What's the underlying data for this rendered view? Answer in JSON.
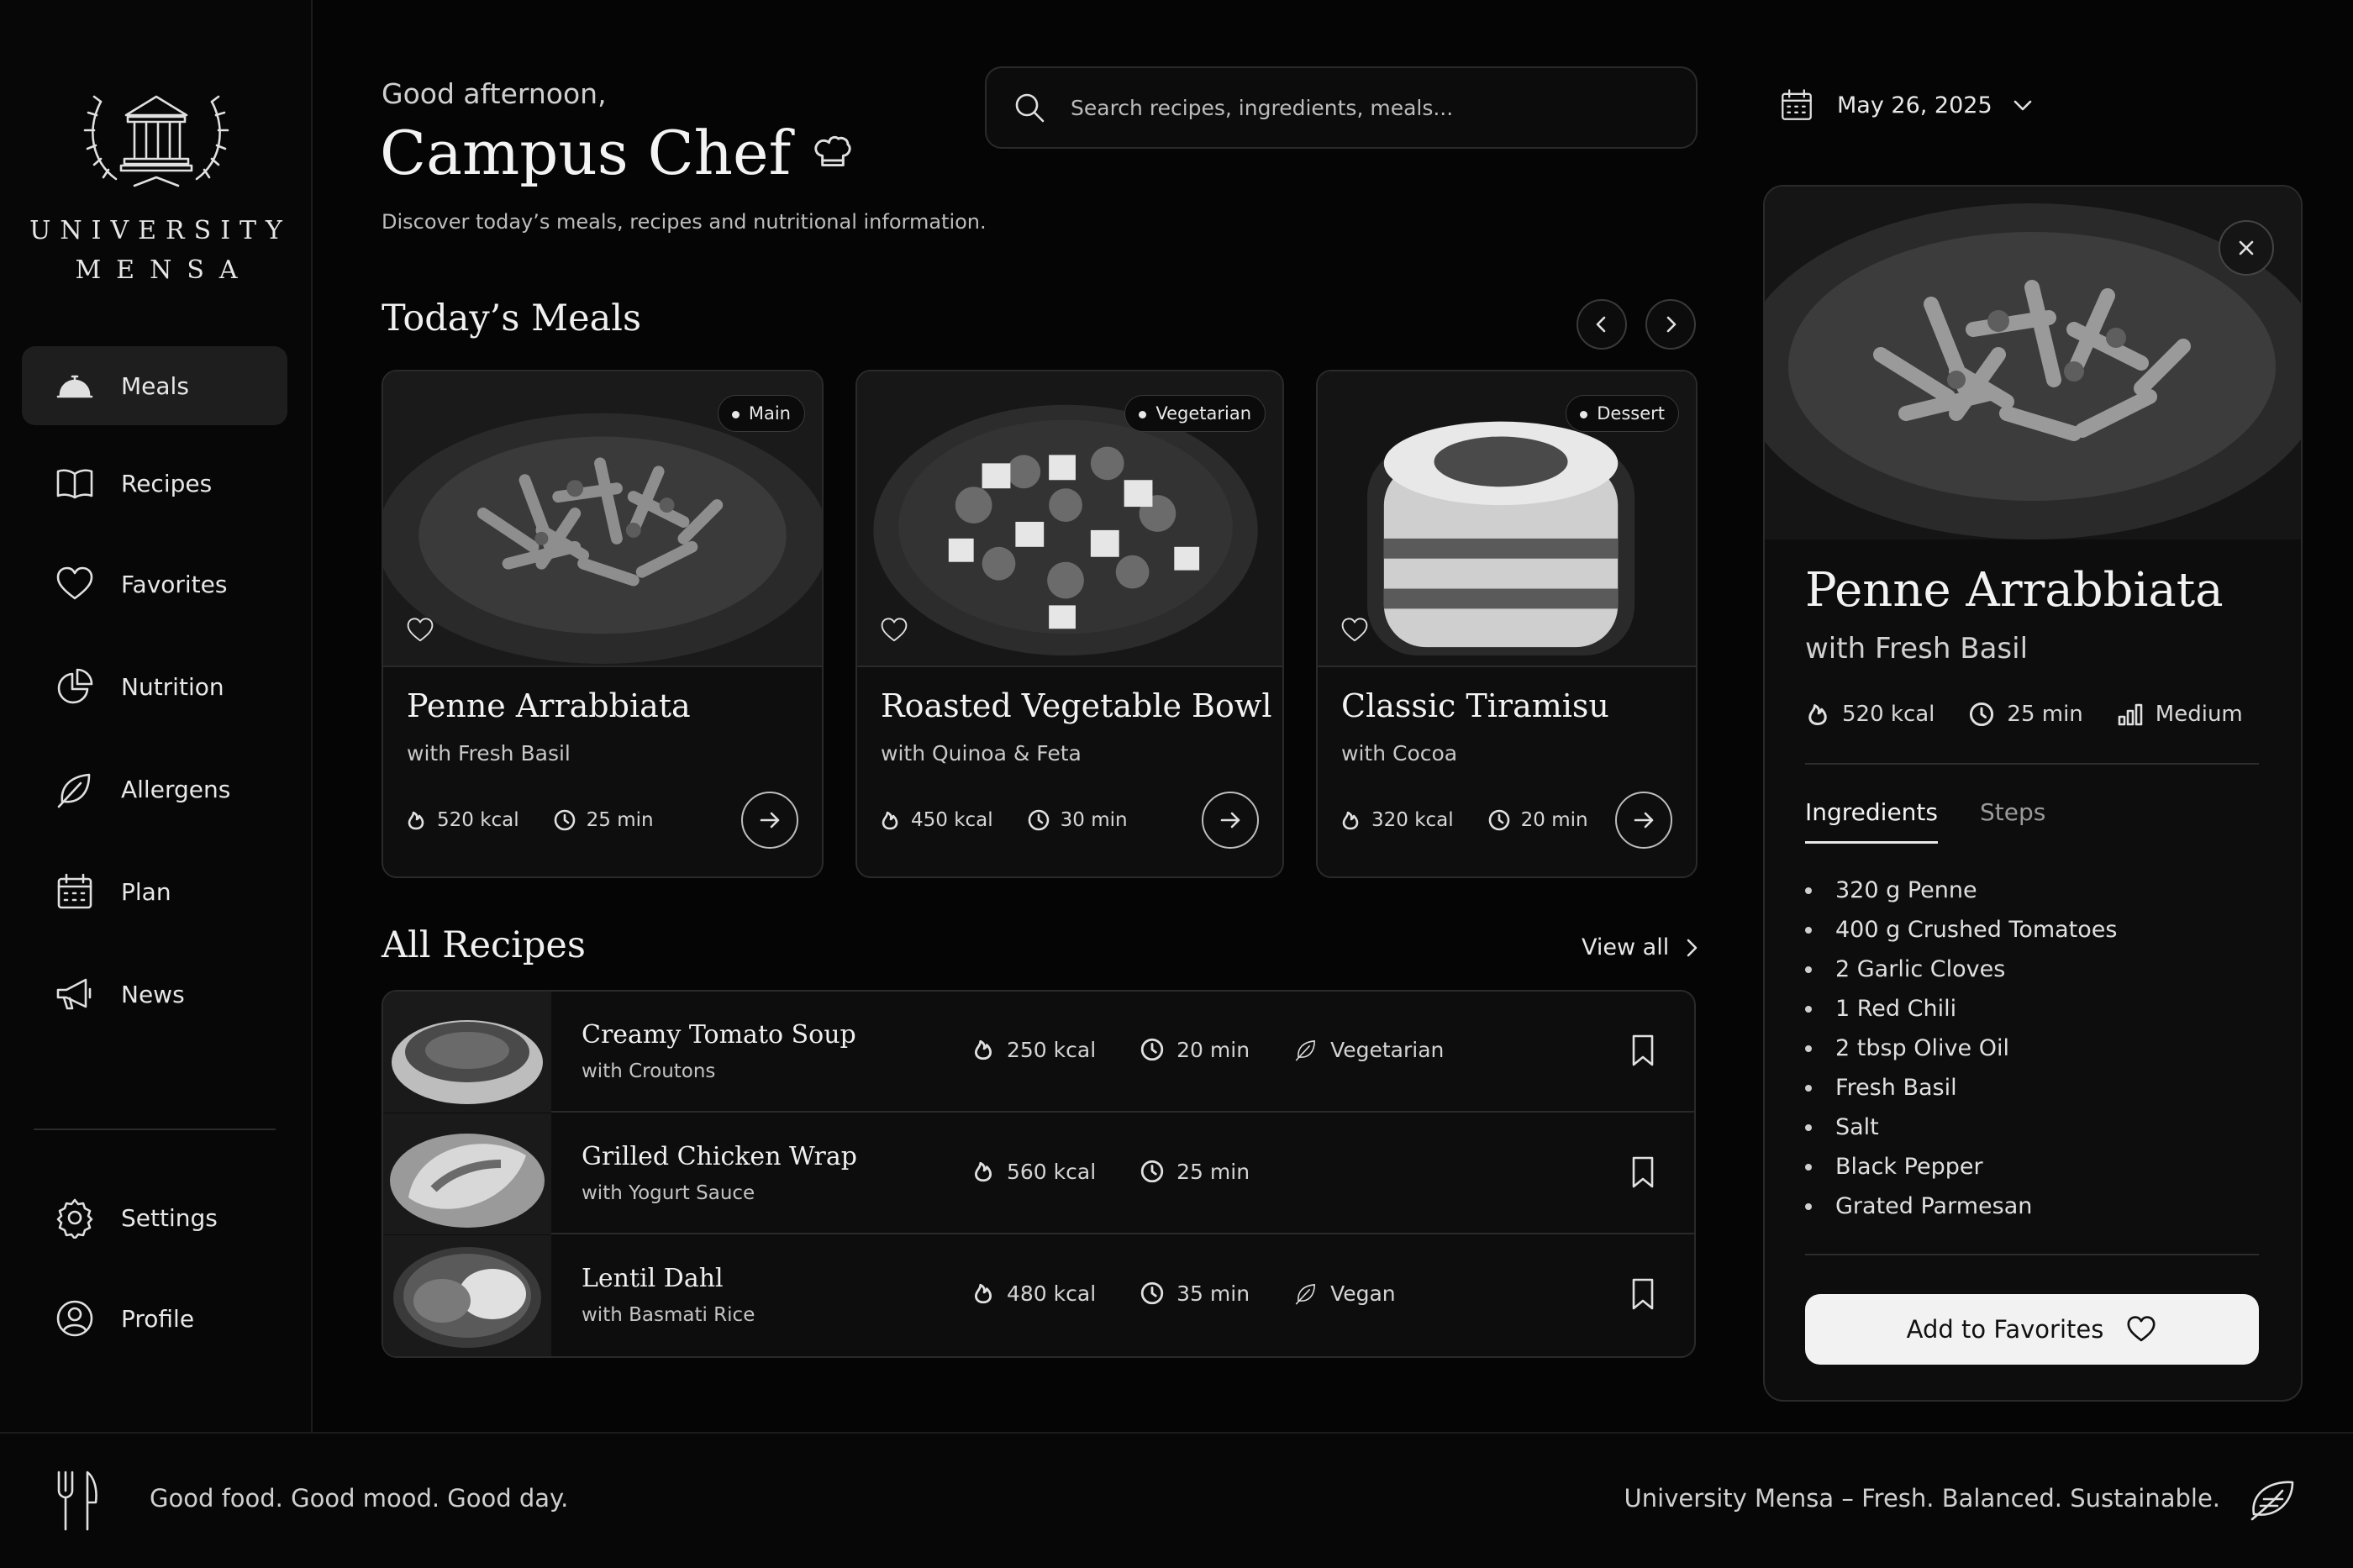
{
  "brand": {
    "line1": "UNIVERSITY",
    "line2": "MENSA",
    "logo_icon": "laurel-building-icon"
  },
  "sidebar": {
    "items": [
      {
        "label": "Meals",
        "icon": "cloche-icon",
        "active": true
      },
      {
        "label": "Recipes",
        "icon": "book-icon",
        "active": false
      },
      {
        "label": "Favorites",
        "icon": "heart-icon",
        "active": false
      },
      {
        "label": "Nutrition",
        "icon": "pie-chart-icon",
        "active": false
      },
      {
        "label": "Allergens",
        "icon": "leaf-icon",
        "active": false
      },
      {
        "label": "Plan",
        "icon": "calendar-icon",
        "active": false
      },
      {
        "label": "News",
        "icon": "megaphone-icon",
        "active": false
      }
    ],
    "bottom_items": [
      {
        "label": "Settings",
        "icon": "gear-icon"
      },
      {
        "label": "Profile",
        "icon": "user-circle-icon"
      }
    ]
  },
  "header": {
    "greeting": "Good afternoon,",
    "title": "Campus Chef",
    "subtitle": "Discover today’s meals, recipes and nutritional information.",
    "search_placeholder": "Search recipes, ingredients, meals...",
    "date": "May 26, 2025"
  },
  "todays_meals": {
    "heading": "Today’s Meals",
    "cards": [
      {
        "badge": "Main",
        "name": "Penne Arrabbiata",
        "subtitle": "with Fresh Basil",
        "kcal": "520 kcal",
        "time": "25 min"
      },
      {
        "badge": "Vegetarian",
        "name": "Roasted Vegetable Bowl",
        "subtitle": "with Quinoa & Feta",
        "kcal": "450 kcal",
        "time": "30 min"
      },
      {
        "badge": "Dessert",
        "name": "Classic Tiramisu",
        "subtitle": "with Cocoa",
        "kcal": "320 kcal",
        "time": "20 min"
      }
    ]
  },
  "all_recipes": {
    "heading": "All Recipes",
    "view_all": "View all",
    "rows": [
      {
        "name": "Creamy Tomato Soup",
        "subtitle": "with Croutons",
        "kcal": "250 kcal",
        "time": "20 min",
        "tag": "Vegetarian"
      },
      {
        "name": "Grilled Chicken Wrap",
        "subtitle": "with Yogurt Sauce",
        "kcal": "560 kcal",
        "time": "25 min",
        "tag": ""
      },
      {
        "name": "Lentil Dahl",
        "subtitle": "with Basmati Rice",
        "kcal": "480 kcal",
        "time": "35 min",
        "tag": "Vegan"
      }
    ]
  },
  "detail": {
    "title": "Penne Arrabbiata",
    "subtitle": "with Fresh Basil",
    "kcal": "520 kcal",
    "time": "25 min",
    "difficulty": "Medium",
    "tabs": [
      "Ingredients",
      "Steps"
    ],
    "active_tab": "Ingredients",
    "ingredients": [
      "320 g Penne",
      "400 g Crushed Tomatoes",
      "2 Garlic Cloves",
      "1 Red Chili",
      "2 tbsp Olive Oil",
      "Fresh Basil",
      "Salt",
      "Black Pepper",
      "Grated Parmesan"
    ],
    "button": "Add to Favorites"
  },
  "footer": {
    "left": "Good food. Good mood. Good day.",
    "right": "University Mensa – Fresh. Balanced. Sustainable."
  }
}
